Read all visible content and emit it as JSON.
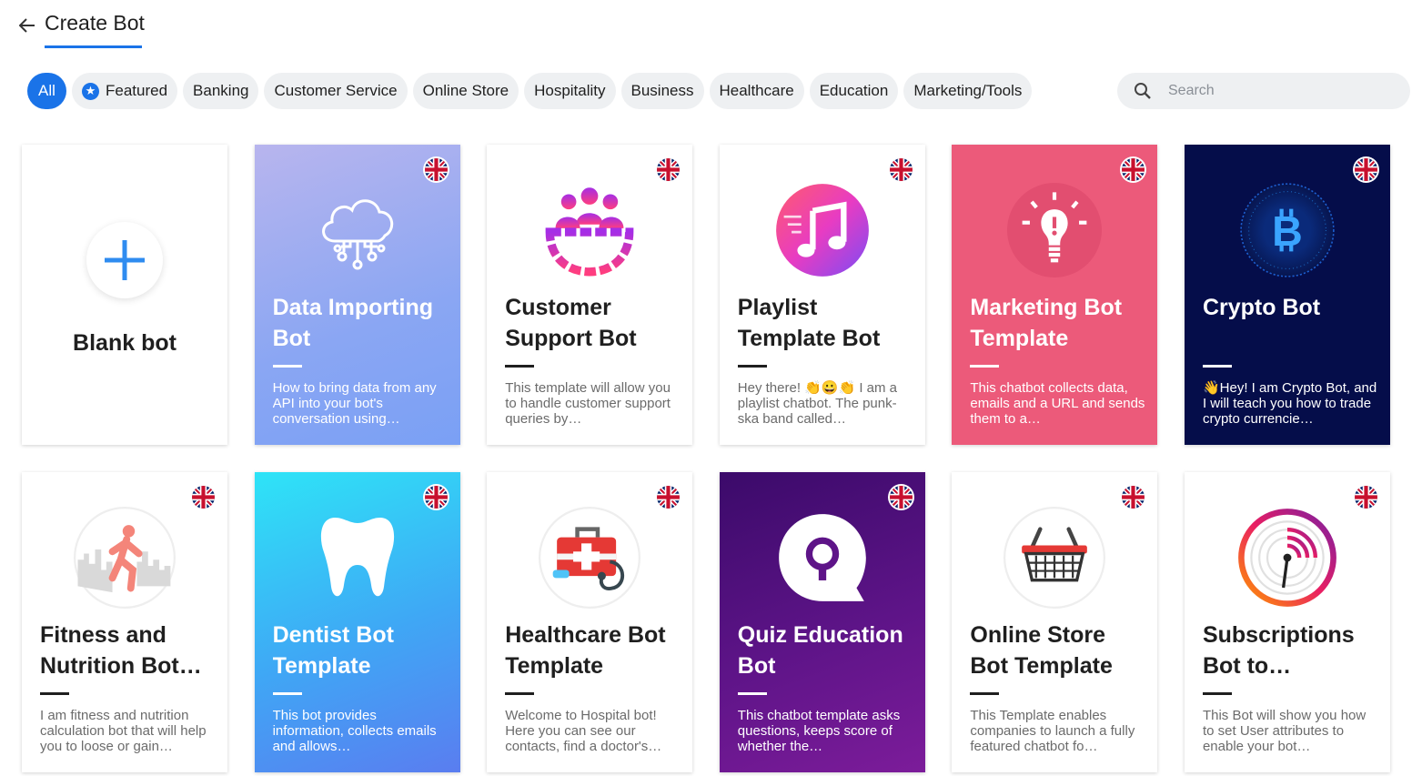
{
  "header": {
    "title": "Create Bot"
  },
  "chips": [
    {
      "label": "All",
      "active": true
    },
    {
      "label": "Featured",
      "icon": "star-icon"
    },
    {
      "label": "Banking"
    },
    {
      "label": "Customer Service"
    },
    {
      "label": "Online Store"
    },
    {
      "label": "Hospitality"
    },
    {
      "label": "Business"
    },
    {
      "label": "Healthcare"
    },
    {
      "label": "Education"
    },
    {
      "label": "Marketing/Tools"
    }
  ],
  "search": {
    "placeholder": "Search",
    "value": ""
  },
  "blank": {
    "title": "Blank bot"
  },
  "cards": [
    {
      "title": "Data Importing Bot",
      "desc": "How to bring data from any API into your bot's conversation using…",
      "icon": "cloud-data-icon"
    },
    {
      "title": "Customer Support Bot",
      "desc": "This template will allow you to handle customer support queries by…",
      "icon": "team-gear-icon"
    },
    {
      "title": "Playlist Template Bot",
      "desc": "Hey there! 👏😀👏 I am a playlist chatbot. The punk-ska band called…",
      "icon": "music-note-icon"
    },
    {
      "title": "Marketing Bot Template",
      "desc": "This chatbot collects data, emails and a URL and sends them to a…",
      "icon": "lightbulb-icon"
    },
    {
      "title": "Crypto Bot",
      "desc": "👋Hey! I am Crypto Bot, and I will teach you how to trade crypto currencie…",
      "icon": "bitcoin-icon"
    },
    {
      "title": "Fitness and Nutrition Bot…",
      "desc": "I am fitness and nutrition calculation bot that will help you to loose or gain…",
      "icon": "runner-icon"
    },
    {
      "title": "Dentist Bot Template",
      "desc": "This bot provides information, collects emails and allows…",
      "icon": "tooth-icon"
    },
    {
      "title": "Healthcare Bot Template",
      "desc": "Welcome to Hospital bot! Here you can see our contacts, find a doctor's…",
      "icon": "medical-kit-icon"
    },
    {
      "title": "Quiz Education Bot",
      "desc": "This chatbot template asks questions, keeps score of whether the…",
      "icon": "quiz-bubble-icon"
    },
    {
      "title": "Online Store Bot Template",
      "desc": "This Template enables companies to launch a fully featured chatbot fo…",
      "icon": "basket-icon"
    },
    {
      "title": "Subscriptions Bot to…",
      "desc": "This Bot will show you how to set User attributes to enable your bot…",
      "icon": "signal-icon"
    }
  ],
  "colors": {
    "accent": "#1a73e8",
    "chipBg": "#eef0f2"
  }
}
